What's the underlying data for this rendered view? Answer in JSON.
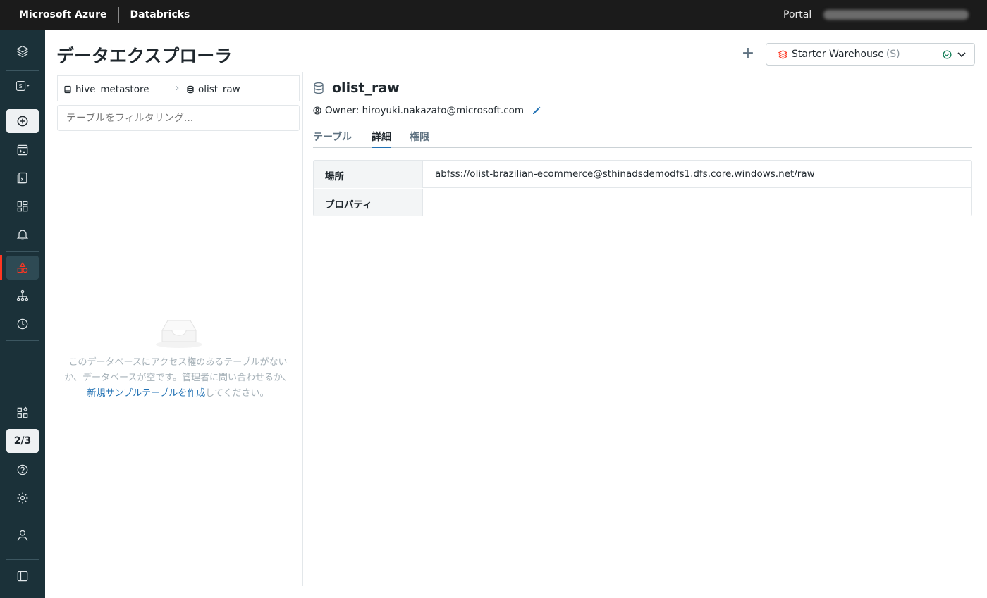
{
  "topbar": {
    "brand": "Microsoft Azure",
    "product": "Databricks",
    "portal": "Portal"
  },
  "sidebar": {
    "items": [
      {
        "name": "databricks-logo-icon"
      },
      {
        "name": "workspace-switch-icon"
      },
      {
        "name": "new-icon"
      },
      {
        "name": "sql-editor-icon"
      },
      {
        "name": "queries-icon"
      },
      {
        "name": "dashboards-icon"
      },
      {
        "name": "alerts-icon"
      },
      {
        "name": "data-explorer-icon"
      },
      {
        "name": "sql-warehouses-icon"
      },
      {
        "name": "query-history-icon"
      },
      {
        "name": "partner-connect-icon"
      },
      {
        "name": "help-icon"
      },
      {
        "name": "settings-icon"
      },
      {
        "name": "user-icon"
      },
      {
        "name": "collapse-sidebar-icon"
      }
    ],
    "progress_counter": "2/3"
  },
  "header": {
    "title": "データエクスプローラ",
    "add_label": "+",
    "warehouse": {
      "name": "Starter Warehouse",
      "size": "(S)",
      "status": "running"
    }
  },
  "left_panel": {
    "breadcrumb": {
      "metastore": "hive_metastore",
      "database": "olist_raw"
    },
    "filter_placeholder": "テーブルをフィルタリング...",
    "empty_message_1": "このデータベースにアクセス権のあるテーブルがない",
    "empty_message_2": "か、データベースが空です。管理者に問い合わせるか、",
    "empty_link": "新規サンプルテーブルを作成",
    "empty_message_3": "してください。"
  },
  "detail": {
    "db_name": "olist_raw",
    "owner_label": "Owner: hiroyuki.nakazato@microsoft.com",
    "tabs": [
      {
        "label": "テーブル",
        "active": false
      },
      {
        "label": "詳細",
        "active": true
      },
      {
        "label": "権限",
        "active": false
      }
    ],
    "rows": [
      {
        "key": "場所",
        "value": "abfss://olist-brazilian-ecommerce@sthinadsdemodfs1.dfs.core.windows.net/raw"
      },
      {
        "key": "プロパティ",
        "value": ""
      }
    ]
  },
  "colors": {
    "topbar": "#1b1b1b",
    "sidebar": "#1b3139",
    "accent": "#ff3621",
    "link": "#2272b4",
    "ok": "#00a972"
  }
}
